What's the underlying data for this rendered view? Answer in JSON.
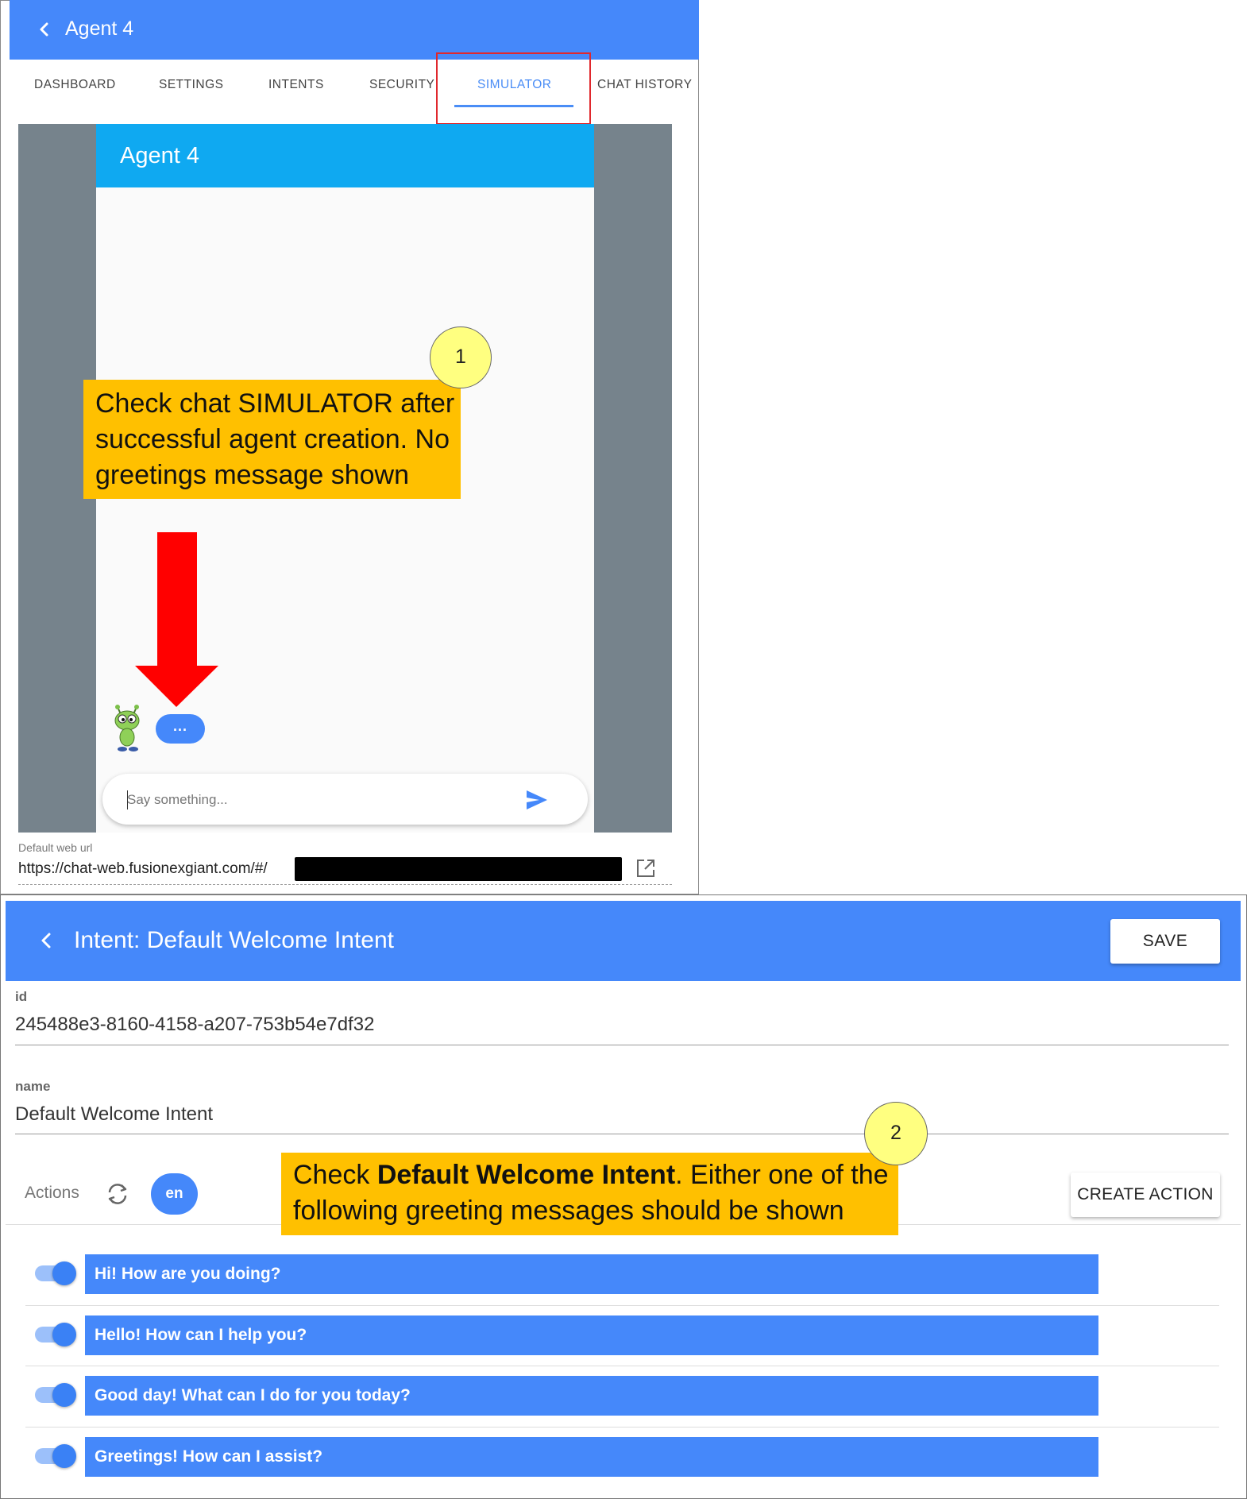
{
  "agent_panel": {
    "back_icon": "chevron-left-icon",
    "title": "Agent 4",
    "tabs": [
      {
        "label": "DASHBOARD",
        "active": false
      },
      {
        "label": "SETTINGS",
        "active": false
      },
      {
        "label": "INTENTS",
        "active": false
      },
      {
        "label": "SECURITY",
        "active": false
      },
      {
        "label": "SIMULATOR",
        "active": true
      },
      {
        "label": "CHAT HISTORY",
        "active": false
      }
    ],
    "active_tab_color": "#4a8df6",
    "simulator": {
      "chat_title": "Agent 4",
      "typing_indicator": "...",
      "input_placeholder": "Say something...",
      "send_icon": "send-icon",
      "avatar_icon": "alien-bot-avatar-icon",
      "header_color": "#0fa9f1"
    },
    "url_label": "Default web url",
    "url_value": "https://chat-web.fusionexgiant.com/#/",
    "open_icon": "open-in-new-icon"
  },
  "intent_panel": {
    "back_icon": "chevron-left-icon",
    "title": "Intent: Default Welcome Intent",
    "save_label": "SAVE",
    "id_label": "id",
    "id_value": "245488e3-8160-4158-a207-753b54e7df32",
    "name_label": "name",
    "name_value": "Default Welcome Intent",
    "actions_label": "Actions",
    "refresh_icon": "refresh-icon",
    "language": "en",
    "create_action_label": "CREATE ACTION",
    "messages": [
      {
        "text": "Hi! How are you doing?",
        "enabled": true
      },
      {
        "text": "Hello! How can I help you?",
        "enabled": true
      },
      {
        "text": "Good day! What can I do for you today?",
        "enabled": true
      },
      {
        "text": "Greetings! How can I assist?",
        "enabled": true
      }
    ],
    "header_color": "#4588fa"
  },
  "annotations": {
    "step1": {
      "number": "1",
      "text": "Check chat SIMULATOR after successful agent creation. No greetings message shown"
    },
    "step2": {
      "number": "2",
      "text_before": "Check ",
      "text_bold": "Default Welcome Intent",
      "text_after": ". Either one of the following greeting messages should be shown"
    },
    "callout_color": "#ffc000",
    "badge_color": "#ffff80",
    "arrow_color": "#ff0000",
    "highlight_color": "#e0282d"
  }
}
